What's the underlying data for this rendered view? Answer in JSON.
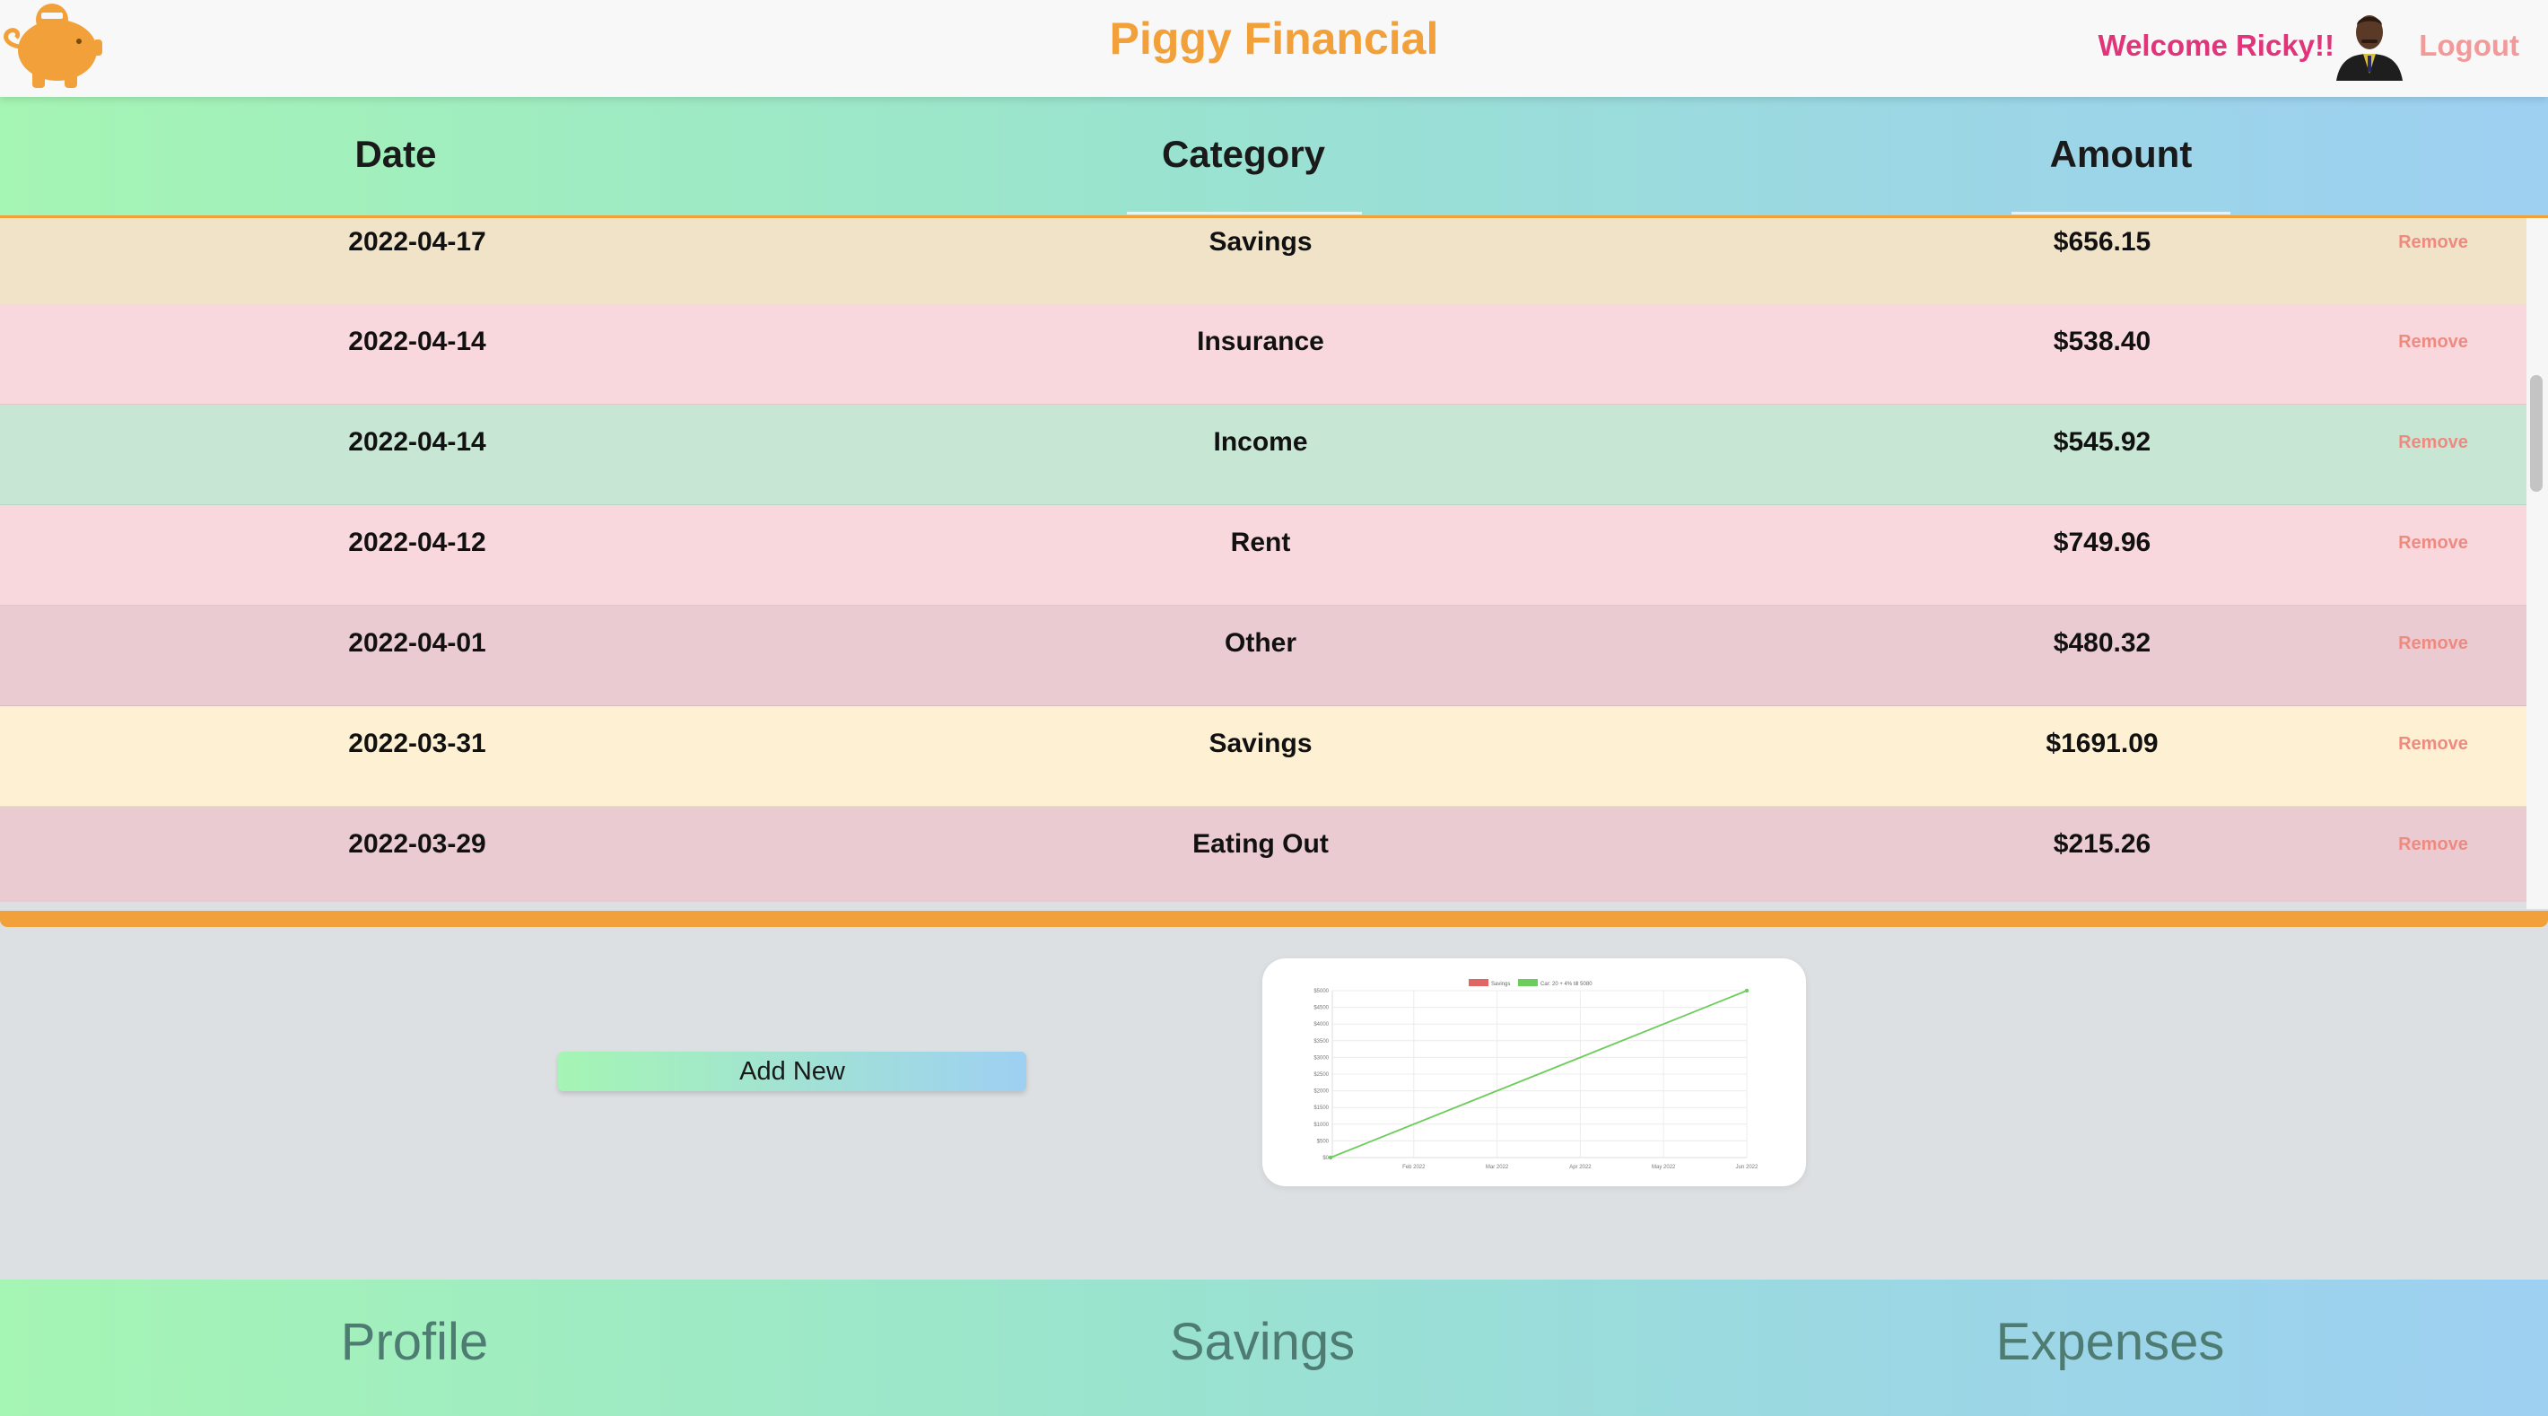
{
  "header": {
    "title": "Piggy Financial",
    "welcome": "Welcome Ricky!!",
    "logout": "Logout",
    "brand_color": "#f2a13a"
  },
  "table": {
    "columns": [
      "Date",
      "Category",
      "Amount"
    ],
    "remove_label": "Remove",
    "rows": [
      {
        "date": "2022-04-17",
        "category": "Savings",
        "amount": "$656.15",
        "color": "#f0e3c8"
      },
      {
        "date": "2022-04-14",
        "category": "Insurance",
        "amount": "$538.40",
        "color": "#f8d8dd"
      },
      {
        "date": "2022-04-14",
        "category": "Income",
        "amount": "$545.92",
        "color": "#c8e6d4"
      },
      {
        "date": "2022-04-12",
        "category": "Rent",
        "amount": "$749.96",
        "color": "#f8d8dd"
      },
      {
        "date": "2022-04-01",
        "category": "Other",
        "amount": "$480.32",
        "color": "#ebcbd2"
      },
      {
        "date": "2022-03-31",
        "category": "Savings",
        "amount": "$1691.09",
        "color": "#fef0d2"
      },
      {
        "date": "2022-03-29",
        "category": "Eating Out",
        "amount": "$215.26",
        "color": "#ebcbd2"
      }
    ]
  },
  "actions": {
    "add_new": "Add New"
  },
  "chart_data": {
    "type": "line",
    "title": "",
    "legend": [
      "Savings",
      "Car: 20 + 4% till 5080"
    ],
    "legend_position": "top",
    "series": [
      {
        "name": "Savings",
        "color": "#e06666",
        "x": [],
        "y": []
      },
      {
        "name": "Car: 20 + 4% till 5080",
        "color": "#6ccc5c",
        "x": [
          "Jan 2022",
          "Jun 2022"
        ],
        "y": [
          0,
          5000
        ]
      }
    ],
    "x_ticks": [
      "Feb 2022",
      "Mar 2022",
      "Apr 2022",
      "May 2022",
      "Jun 2022"
    ],
    "y_ticks": [
      "$0",
      "$500",
      "$1000",
      "$1500",
      "$2000",
      "$2500",
      "$3000",
      "$3500",
      "$4000",
      "$4500",
      "$5000"
    ],
    "ylim": [
      0,
      5000
    ],
    "grid": true
  },
  "nav": {
    "items": [
      "Profile",
      "Savings",
      "Expenses"
    ]
  }
}
